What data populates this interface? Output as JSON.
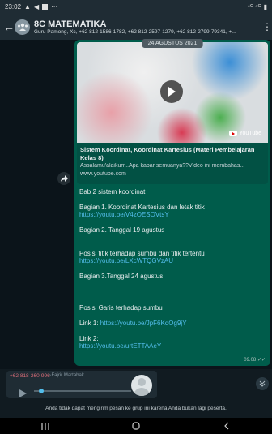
{
  "status_bar": {
    "time": "23:02",
    "right_text": "⁴ᴳ ⁴ᴳ"
  },
  "header": {
    "title": "8C MATEMATIKA",
    "subtitle": "Guru Pamong, Xc, +62 812-1586-1782, +62 812-2597-1279, +62 812-2799-79341, +..."
  },
  "chat": {
    "date_label": "24 AGUSTUS 2021",
    "preview": {
      "title": "Sistem Koordinat, Koordinat Kartesius (Materi Pembelajaran Kelas 8)",
      "description": "Assalamu'alaikum..Apa kabar semuanya??Video ini membahas...",
      "domain": "www.youtube.com",
      "brand": "YouTube"
    },
    "message": {
      "line1": "Bab 2 sistem koordinat",
      "line2": "Bagian 1. Koordinat Kartesius dan letak titik",
      "link1": "https://youtu.be/V4zOESOVtsY",
      "line3": "Bagian 2. Tanggal 19 agustus",
      "line4": "Posisi titik terhadap sumbu dan titik tertentu",
      "link2": "https://youtu.be/LXcWTQGVzAU",
      "line5": "Bagian 3.Tanggal 24 agustus",
      "line6": "Posisi Garis terhadap sumbu",
      "link_label_1": "Link 1: ",
      "link3": "https://youtu.be/JpF6KqOg9jY",
      "link_label_2": "Link 2:",
      "link4": "https://youtu.be/urtETTAAeY",
      "time": "09.08"
    }
  },
  "audio": {
    "sender": "+62 818-260-996",
    "sender_name": "~Fajrir Martabak..."
  },
  "notice": "Anda tidak dapat mengirim pesan ke grup ini karena Anda bukan lagi peserta.",
  "colors": {
    "header_bg": "#1f2c34",
    "bubble_out": "#005c4b",
    "link": "#53bdeb"
  }
}
